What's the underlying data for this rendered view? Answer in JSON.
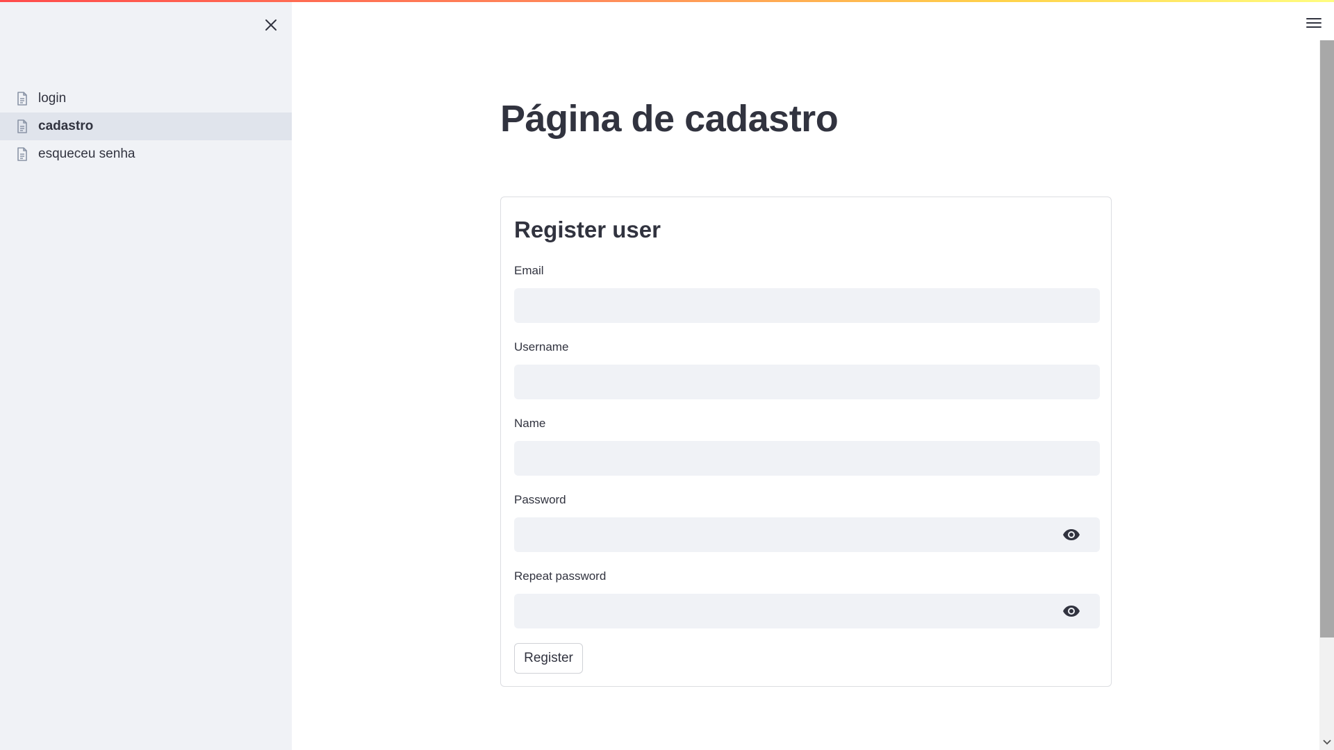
{
  "sidebar": {
    "close_icon": "close-icon",
    "items": [
      {
        "label": "login",
        "icon": "document-icon",
        "active": false
      },
      {
        "label": "cadastro",
        "icon": "document-icon",
        "active": true
      },
      {
        "label": "esqueceu senha",
        "icon": "document-icon",
        "active": false
      }
    ]
  },
  "header": {
    "menu_icon": "hamburger-menu-icon"
  },
  "main": {
    "page_title": "Página de cadastro",
    "form": {
      "title": "Register user",
      "fields": {
        "email": {
          "label": "Email",
          "value": ""
        },
        "username": {
          "label": "Username",
          "value": ""
        },
        "name": {
          "label": "Name",
          "value": ""
        },
        "password": {
          "label": "Password",
          "value": "",
          "icon": "eye-icon"
        },
        "repeat_password": {
          "label": "Repeat password",
          "value": "",
          "icon": "eye-icon"
        }
      },
      "submit_label": "Register"
    }
  },
  "colors": {
    "sidebar_bg": "#f0f2f6",
    "active_item_bg": "#e0e4ec",
    "input_bg": "#f0f2f6",
    "text": "#31333f",
    "accent_gradient_start": "#ff4b4b",
    "accent_gradient_end": "#fffd80"
  }
}
